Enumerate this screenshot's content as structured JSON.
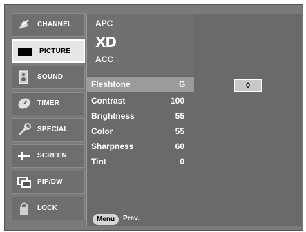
{
  "sidebar": {
    "items": [
      {
        "label": "CHANNEL",
        "icon": "satellite-dish-icon"
      },
      {
        "label": "PICTURE",
        "icon": "monitor-icon"
      },
      {
        "label": "SOUND",
        "icon": "speaker-icon"
      },
      {
        "label": "TIMER",
        "icon": "clock-icon"
      },
      {
        "label": "SPECIAL",
        "icon": "wrench-icon"
      },
      {
        "label": "SCREEN",
        "icon": "crosshair-icon"
      },
      {
        "label": "PIP/DW",
        "icon": "pip-windows-icon"
      },
      {
        "label": "LOCK",
        "icon": "padlock-icon"
      }
    ],
    "active_index": 1
  },
  "menu": {
    "top": {
      "apc": "APC",
      "xd": "XD",
      "acc": "ACC"
    },
    "fleshtone": {
      "label": "Fleshtone",
      "value": "G"
    },
    "items": [
      {
        "label": "Contrast",
        "value": "100"
      },
      {
        "label": "Brightness",
        "value": "55"
      },
      {
        "label": "Color",
        "value": "55"
      },
      {
        "label": "Sharpness",
        "value": "60"
      },
      {
        "label": "Tint",
        "value": "0"
      }
    ],
    "menu_button": "Menu",
    "prev_label": "Prev."
  },
  "right": {
    "fleshtone_value": "0"
  }
}
